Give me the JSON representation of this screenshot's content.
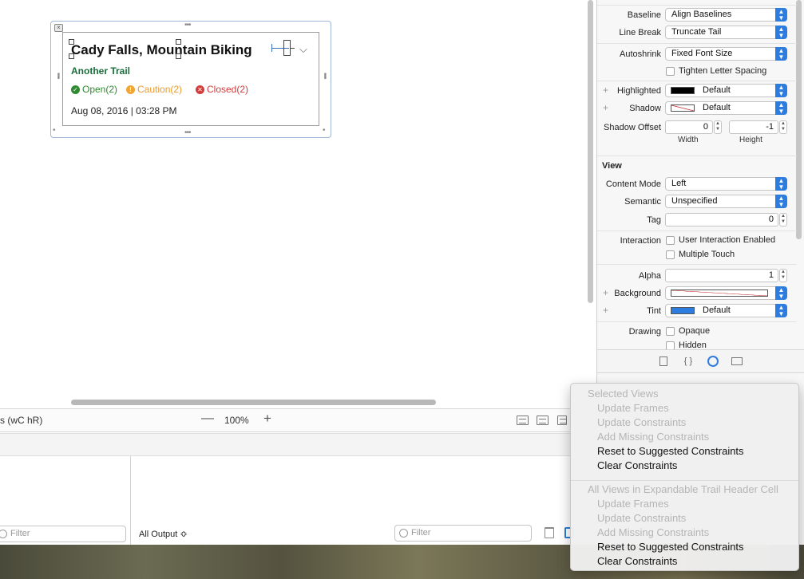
{
  "canvas": {
    "cell": {
      "title": "Cady Falls, Mountain Biking",
      "trail_name": "Another Trail",
      "statuses": {
        "open": "Open(2)",
        "caution": "Caution(2)",
        "closed": "Closed(2)"
      },
      "date": "Aug 08, 2016 | 03:28 PM"
    }
  },
  "toolbar": {
    "view_as": "s (wC hR)",
    "zoom_out": "—",
    "zoom_level": "100%",
    "zoom_in": "+"
  },
  "debug": {
    "filter_left_placeholder": "Filter",
    "all_output": "All Output ≎",
    "filter_right_placeholder": "Filter"
  },
  "inspector": {
    "baseline": {
      "label": "Baseline",
      "value": "Align Baselines"
    },
    "line_break": {
      "label": "Line Break",
      "value": "Truncate Tail"
    },
    "autoshrink": {
      "label": "Autoshrink",
      "value": "Fixed Font Size"
    },
    "tighten": {
      "label": "Tighten Letter Spacing"
    },
    "highlighted": {
      "label": "Highlighted",
      "value": "Default"
    },
    "shadow": {
      "label": "Shadow",
      "value": "Default"
    },
    "shadow_offset": {
      "label": "Shadow Offset",
      "width": "0",
      "height": "-1",
      "width_label": "Width",
      "height_label": "Height"
    },
    "view_section": "View",
    "content_mode": {
      "label": "Content Mode",
      "value": "Left"
    },
    "semantic": {
      "label": "Semantic",
      "value": "Unspecified"
    },
    "tag": {
      "label": "Tag",
      "value": "0"
    },
    "interaction": {
      "label": "Interaction",
      "option1": "User Interaction Enabled",
      "option2": "Multiple Touch"
    },
    "alpha": {
      "label": "Alpha",
      "value": "1"
    },
    "background": {
      "label": "Background"
    },
    "tint": {
      "label": "Tint",
      "value": "Default"
    },
    "drawing": {
      "label": "Drawing",
      "option1": "Opaque",
      "option2": "Hidden"
    }
  },
  "menu": {
    "selected_header": "Selected Views",
    "selected_items": [
      "Update Frames",
      "Update Constraints",
      "Add Missing Constraints",
      "Reset to Suggested Constraints",
      "Clear Constraints"
    ],
    "all_header": "All Views in Expandable Trail Header Cell",
    "all_items": [
      "Update Frames",
      "Update Constraints",
      "Add Missing Constraints",
      "Reset to Suggested Constraints",
      "Clear Constraints"
    ]
  },
  "colors": {
    "accent": "#2d7ce0",
    "open": "#2f8a32",
    "caution": "#e99b2e",
    "closed": "#d33b3b",
    "trail": "#1b6d3b"
  },
  "icons": [
    "close-icon",
    "chevron-down-icon",
    "checkmark-icon",
    "warning-icon",
    "x-icon",
    "zoom-out-icon",
    "zoom-in-icon",
    "filter-icon",
    "trash-icon",
    "split-view-icon",
    "file-icon",
    "braces-icon",
    "identity-icon",
    "size-icon"
  ]
}
